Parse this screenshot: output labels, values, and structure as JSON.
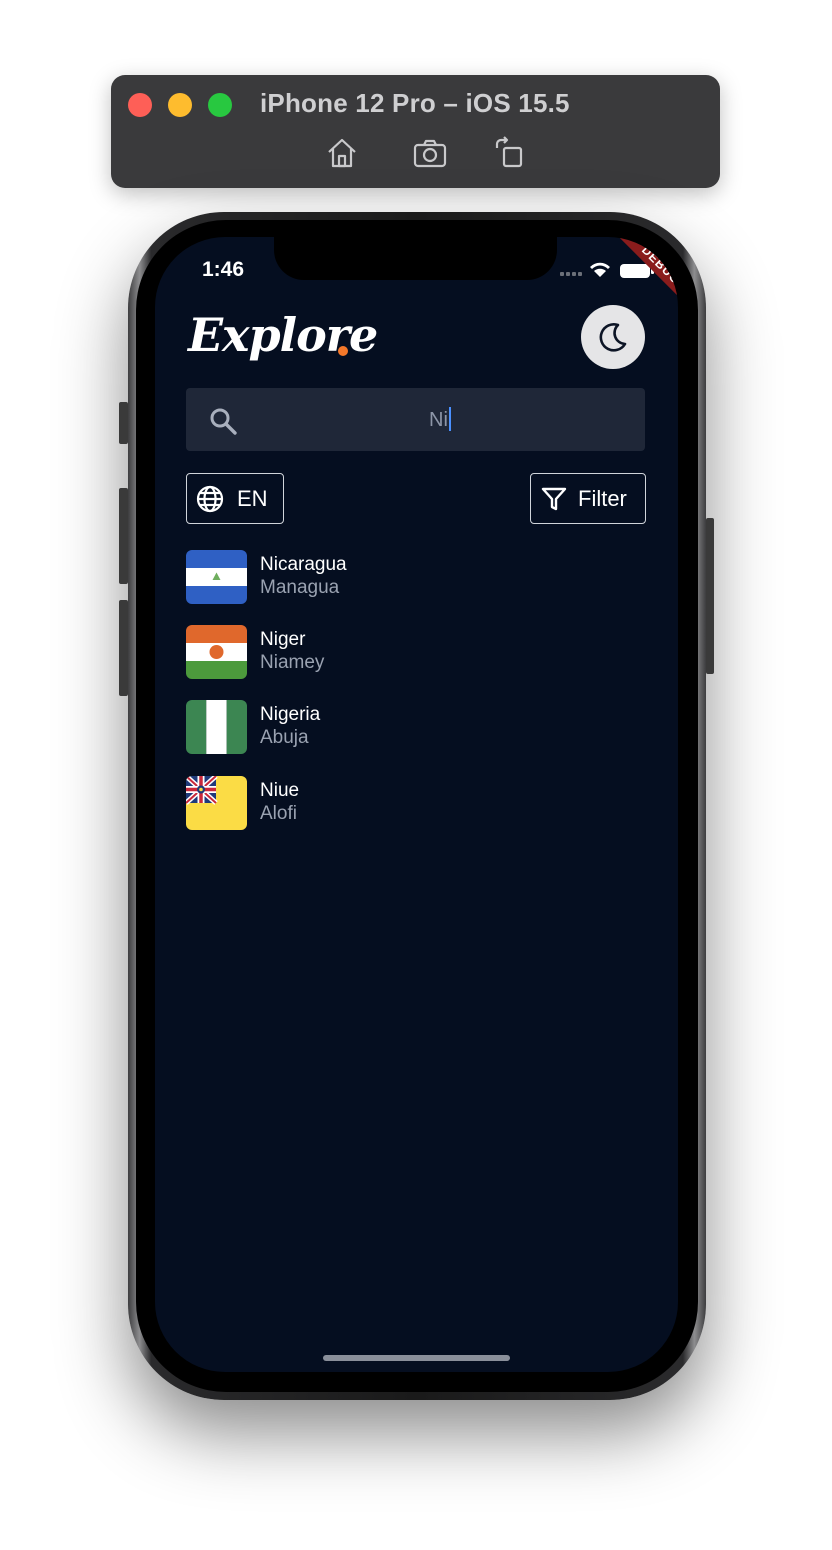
{
  "simulator": {
    "title": "iPhone 12 Pro – iOS 15.5",
    "tools": [
      "home-icon",
      "screenshot-icon",
      "rotate-icon"
    ]
  },
  "status_bar": {
    "time": "1:46",
    "debug_label": "DEBUG"
  },
  "app": {
    "logo": "Explore",
    "logo_dot_color": "#f5782a",
    "theme_toggle_icon": "moon-icon",
    "search": {
      "value": "Ni",
      "icon": "search-icon"
    },
    "language_button": {
      "label": "EN",
      "icon": "globe-icon"
    },
    "filter_button": {
      "label": "Filter",
      "icon": "filter-icon"
    },
    "countries": [
      {
        "name": "Nicaragua",
        "capital": "Managua",
        "flag": "nicaragua-flag"
      },
      {
        "name": "Niger",
        "capital": "Niamey",
        "flag": "niger-flag"
      },
      {
        "name": "Nigeria",
        "capital": "Abuja",
        "flag": "nigeria-flag"
      },
      {
        "name": "Niue",
        "capital": "Alofi",
        "flag": "niue-flag"
      }
    ]
  },
  "colors": {
    "screen_bg": "#050e20",
    "search_bg": "#1f2738",
    "accent": "#f5782a"
  }
}
